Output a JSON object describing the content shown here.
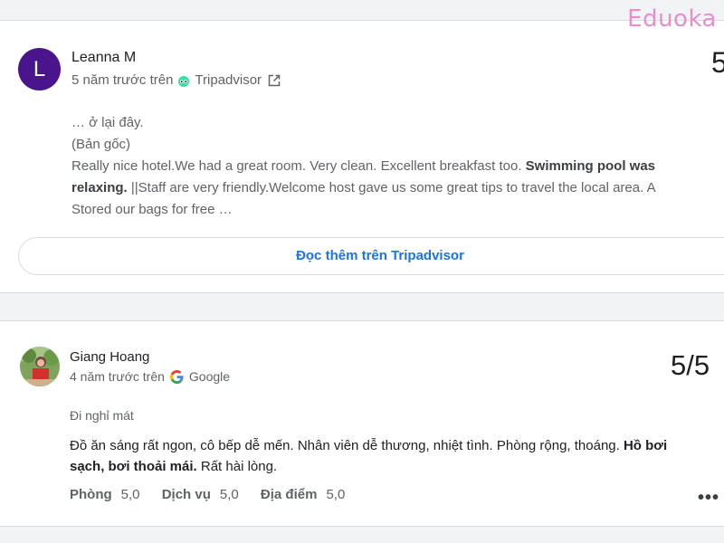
{
  "watermark": {
    "text": "Eduoka"
  },
  "review1": {
    "avatar_initial": "L",
    "avatar_color": "#4a148c",
    "name": "Leanna M",
    "time": "5 năm trước trên",
    "source": "Tripadvisor",
    "source_icon": "tripadvisor-icon",
    "link_icon": "open-in-new-icon",
    "score": "5",
    "lines": {
      "l1": "… ở lại đây.",
      "l2": "(Bản gốc)",
      "l3a": "Really nice hotel.We had a great room. Very clean. Excellent breakfast too. ",
      "l3b": "Swimming pool was",
      "l4a": "relaxing.",
      "l4b": " ||Staff are very friendly.Welcome host gave us some great tips to travel the local area. A",
      "l5": "Stored our bags for free …"
    },
    "read_more": "Đọc thêm trên Tripadvisor"
  },
  "review2": {
    "name": "Giang Hoang",
    "time": "4 năm trước trên",
    "source": "Google",
    "source_icon": "google-icon",
    "score": "5/5",
    "trip_type": "Đi nghỉ mát",
    "text_a": "Đồ ăn sáng rất ngon, cô bếp dễ mến. Nhân viên dễ thương, nhiệt tình. Phòng rộng, thoáng. ",
    "text_b": "Hồ bơi sạch, bơi thoải mái.",
    "text_c": " Rất hài lòng.",
    "ratings": [
      {
        "label": "Phòng",
        "value": "5,0"
      },
      {
        "label": "Dịch vụ",
        "value": "5,0"
      },
      {
        "label": "Địa điểm",
        "value": "5,0"
      }
    ],
    "more_label": "•••"
  },
  "colors": {
    "accent": "#1a73e8",
    "tripadvisor": "#34e0a1",
    "watermark": "#e58fcf"
  }
}
